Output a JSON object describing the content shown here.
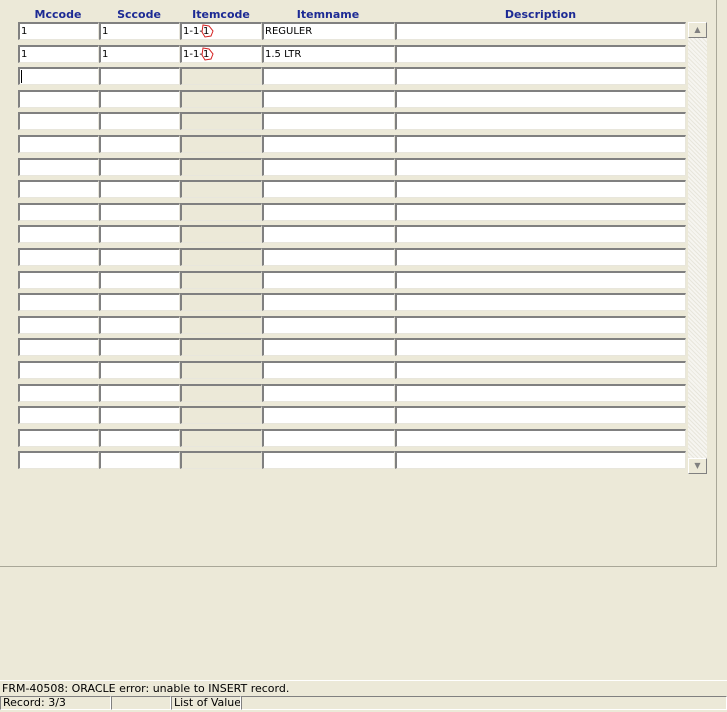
{
  "columns": {
    "mccode": "Mccode",
    "sccode": "Sccode",
    "itemcode": "Itemcode",
    "itemname": "Itemname",
    "description": "Description"
  },
  "rows": [
    {
      "mccode": "1",
      "sccode": "1",
      "itemcode": "1-1-1",
      "itemname": "REGULER",
      "description": ""
    },
    {
      "mccode": "1",
      "sccode": "1",
      "itemcode": "1-1-1",
      "itemname": "1.5 LTR",
      "description": ""
    }
  ],
  "scrollbar": {
    "up": "▲",
    "down": "▼"
  },
  "status": {
    "message": "FRM-40508: ORACLE error: unable to INSERT record.",
    "record": "Record: 3/3",
    "middle": "",
    "lov": "List of Values",
    "extra": ""
  },
  "colors": {
    "header_text": "#1c2a94",
    "background": "#ece9d8",
    "annotation": "#d42020"
  }
}
